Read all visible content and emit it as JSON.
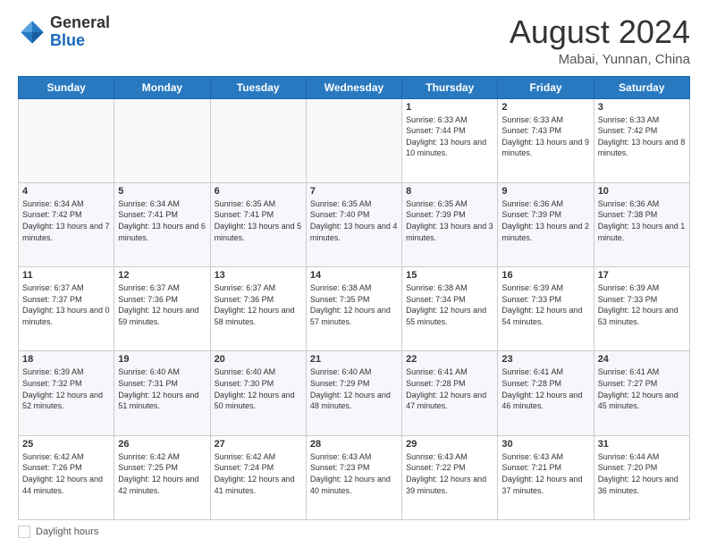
{
  "header": {
    "logo_general": "General",
    "logo_blue": "Blue",
    "month_title": "August 2024",
    "location": "Mabai, Yunnan, China"
  },
  "days_of_week": [
    "Sunday",
    "Monday",
    "Tuesday",
    "Wednesday",
    "Thursday",
    "Friday",
    "Saturday"
  ],
  "weeks": [
    [
      {
        "day": "",
        "info": ""
      },
      {
        "day": "",
        "info": ""
      },
      {
        "day": "",
        "info": ""
      },
      {
        "day": "",
        "info": ""
      },
      {
        "day": "1",
        "info": "Sunrise: 6:33 AM\nSunset: 7:44 PM\nDaylight: 13 hours\nand 10 minutes."
      },
      {
        "day": "2",
        "info": "Sunrise: 6:33 AM\nSunset: 7:43 PM\nDaylight: 13 hours\nand 9 minutes."
      },
      {
        "day": "3",
        "info": "Sunrise: 6:33 AM\nSunset: 7:42 PM\nDaylight: 13 hours\nand 8 minutes."
      }
    ],
    [
      {
        "day": "4",
        "info": "Sunrise: 6:34 AM\nSunset: 7:42 PM\nDaylight: 13 hours\nand 7 minutes."
      },
      {
        "day": "5",
        "info": "Sunrise: 6:34 AM\nSunset: 7:41 PM\nDaylight: 13 hours\nand 6 minutes."
      },
      {
        "day": "6",
        "info": "Sunrise: 6:35 AM\nSunset: 7:41 PM\nDaylight: 13 hours\nand 5 minutes."
      },
      {
        "day": "7",
        "info": "Sunrise: 6:35 AM\nSunset: 7:40 PM\nDaylight: 13 hours\nand 4 minutes."
      },
      {
        "day": "8",
        "info": "Sunrise: 6:35 AM\nSunset: 7:39 PM\nDaylight: 13 hours\nand 3 minutes."
      },
      {
        "day": "9",
        "info": "Sunrise: 6:36 AM\nSunset: 7:39 PM\nDaylight: 13 hours\nand 2 minutes."
      },
      {
        "day": "10",
        "info": "Sunrise: 6:36 AM\nSunset: 7:38 PM\nDaylight: 13 hours\nand 1 minute."
      }
    ],
    [
      {
        "day": "11",
        "info": "Sunrise: 6:37 AM\nSunset: 7:37 PM\nDaylight: 13 hours\nand 0 minutes."
      },
      {
        "day": "12",
        "info": "Sunrise: 6:37 AM\nSunset: 7:36 PM\nDaylight: 12 hours\nand 59 minutes."
      },
      {
        "day": "13",
        "info": "Sunrise: 6:37 AM\nSunset: 7:36 PM\nDaylight: 12 hours\nand 58 minutes."
      },
      {
        "day": "14",
        "info": "Sunrise: 6:38 AM\nSunset: 7:35 PM\nDaylight: 12 hours\nand 57 minutes."
      },
      {
        "day": "15",
        "info": "Sunrise: 6:38 AM\nSunset: 7:34 PM\nDaylight: 12 hours\nand 55 minutes."
      },
      {
        "day": "16",
        "info": "Sunrise: 6:39 AM\nSunset: 7:33 PM\nDaylight: 12 hours\nand 54 minutes."
      },
      {
        "day": "17",
        "info": "Sunrise: 6:39 AM\nSunset: 7:33 PM\nDaylight: 12 hours\nand 53 minutes."
      }
    ],
    [
      {
        "day": "18",
        "info": "Sunrise: 6:39 AM\nSunset: 7:32 PM\nDaylight: 12 hours\nand 52 minutes."
      },
      {
        "day": "19",
        "info": "Sunrise: 6:40 AM\nSunset: 7:31 PM\nDaylight: 12 hours\nand 51 minutes."
      },
      {
        "day": "20",
        "info": "Sunrise: 6:40 AM\nSunset: 7:30 PM\nDaylight: 12 hours\nand 50 minutes."
      },
      {
        "day": "21",
        "info": "Sunrise: 6:40 AM\nSunset: 7:29 PM\nDaylight: 12 hours\nand 48 minutes."
      },
      {
        "day": "22",
        "info": "Sunrise: 6:41 AM\nSunset: 7:28 PM\nDaylight: 12 hours\nand 47 minutes."
      },
      {
        "day": "23",
        "info": "Sunrise: 6:41 AM\nSunset: 7:28 PM\nDaylight: 12 hours\nand 46 minutes."
      },
      {
        "day": "24",
        "info": "Sunrise: 6:41 AM\nSunset: 7:27 PM\nDaylight: 12 hours\nand 45 minutes."
      }
    ],
    [
      {
        "day": "25",
        "info": "Sunrise: 6:42 AM\nSunset: 7:26 PM\nDaylight: 12 hours\nand 44 minutes."
      },
      {
        "day": "26",
        "info": "Sunrise: 6:42 AM\nSunset: 7:25 PM\nDaylight: 12 hours\nand 42 minutes."
      },
      {
        "day": "27",
        "info": "Sunrise: 6:42 AM\nSunset: 7:24 PM\nDaylight: 12 hours\nand 41 minutes."
      },
      {
        "day": "28",
        "info": "Sunrise: 6:43 AM\nSunset: 7:23 PM\nDaylight: 12 hours\nand 40 minutes."
      },
      {
        "day": "29",
        "info": "Sunrise: 6:43 AM\nSunset: 7:22 PM\nDaylight: 12 hours\nand 39 minutes."
      },
      {
        "day": "30",
        "info": "Sunrise: 6:43 AM\nSunset: 7:21 PM\nDaylight: 12 hours\nand 37 minutes."
      },
      {
        "day": "31",
        "info": "Sunrise: 6:44 AM\nSunset: 7:20 PM\nDaylight: 12 hours\nand 36 minutes."
      }
    ]
  ],
  "footer": {
    "label": "Daylight hours"
  }
}
